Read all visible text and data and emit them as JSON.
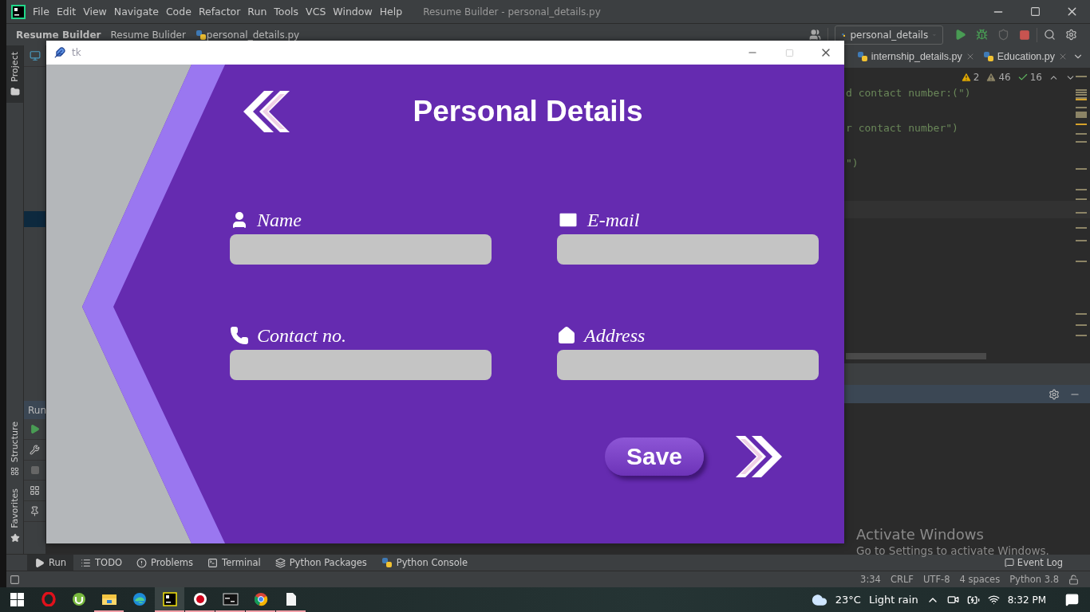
{
  "ide": {
    "menu": [
      "File",
      "Edit",
      "View",
      "Navigate",
      "Code",
      "Refactor",
      "Run",
      "Tools",
      "VCS",
      "Window",
      "Help"
    ],
    "window_title": "Resume Builder - personal_details.py",
    "breadcrumbs": [
      "Resume Builder",
      "Resume Bulider",
      "personal_details.py"
    ],
    "run_config": "personal_details",
    "tool_strip": [
      {
        "label": "Project",
        "kind": "folder",
        "selected": true
      },
      {
        "label": "Structure",
        "kind": "structure",
        "selected": false
      },
      {
        "label": "Favorites",
        "kind": "star",
        "selected": false
      }
    ],
    "editor_tabs": [
      "internship_details.py",
      "Education.py"
    ],
    "inspections": [
      {
        "kind": "warning",
        "count": "2"
      },
      {
        "kind": "weak",
        "count": "46"
      },
      {
        "kind": "typo",
        "count": "16"
      }
    ],
    "code_lines": [
      "d contact number:(\")",
      "r contact number\")",
      "\")"
    ],
    "run_panel": {
      "title": "Run"
    },
    "bottom_tabs": [
      {
        "label": "Run",
        "kind": "run",
        "selected": true
      },
      {
        "label": "TODO",
        "kind": "todo",
        "selected": false
      },
      {
        "label": "Problems",
        "kind": "problems",
        "selected": false
      },
      {
        "label": "Terminal",
        "kind": "terminal",
        "selected": false
      },
      {
        "label": "Python Packages",
        "kind": "packages",
        "selected": false
      },
      {
        "label": "Python Console",
        "kind": "console",
        "selected": false
      }
    ],
    "event_log": "Event Log",
    "status_bar": [
      "3:34",
      "CRLF",
      "UTF-8",
      "4 spaces",
      "Python 3.8"
    ]
  },
  "activation": {
    "title": "Activate Windows",
    "hint": "Go to Settings to activate Windows."
  },
  "tk_window": {
    "title": "tk",
    "heading": "Personal Details",
    "fields": [
      {
        "kind": "person",
        "label": "Name"
      },
      {
        "kind": "mail",
        "label": "E-mail"
      },
      {
        "kind": "phone",
        "label": "Contact no."
      },
      {
        "kind": "home",
        "label": "Address"
      }
    ],
    "save": "Save"
  },
  "taskbar": {
    "apps": [
      {
        "kind": "opera",
        "running": false,
        "selected": false
      },
      {
        "kind": "utorrent",
        "running": false,
        "selected": false
      },
      {
        "kind": "explorer",
        "running": true,
        "selected": false
      },
      {
        "kind": "edge",
        "running": false,
        "selected": false
      },
      {
        "kind": "pycharm",
        "running": true,
        "selected": true
      },
      {
        "kind": "recorder",
        "running": true,
        "selected": false
      },
      {
        "kind": "cmd",
        "running": true,
        "selected": false
      },
      {
        "kind": "chrome",
        "running": true,
        "selected": false
      },
      {
        "kind": "notepad",
        "running": true,
        "selected": false
      }
    ],
    "temperature": "23°C",
    "condition": "Light rain",
    "clock": "8:32 PM"
  }
}
